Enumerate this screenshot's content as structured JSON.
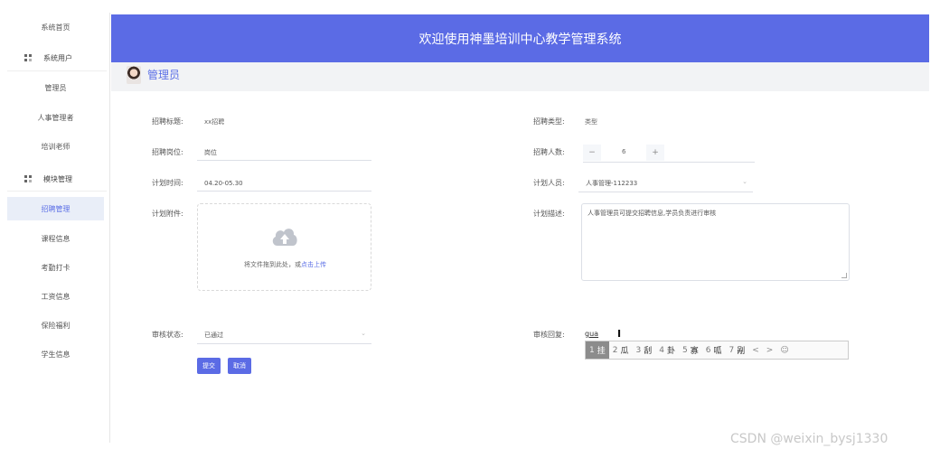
{
  "sidebar": {
    "items": [
      {
        "label": "系统首页"
      },
      {
        "label": "系统用户",
        "group": true
      },
      {
        "label": "管理员"
      },
      {
        "label": "人事管理者"
      },
      {
        "label": "培训老师"
      },
      {
        "label": "模块管理",
        "group": true
      },
      {
        "label": "招聘管理",
        "active": true
      },
      {
        "label": "课程信息"
      },
      {
        "label": "考勤打卡"
      },
      {
        "label": "工资信息"
      },
      {
        "label": "保险福利"
      },
      {
        "label": "学生信息"
      }
    ]
  },
  "header": {
    "title": "欢迎使用神墨培训中心教学管理系统"
  },
  "user": {
    "name": "管理员"
  },
  "form": {
    "recruit_title_label": "招聘标题:",
    "recruit_title_value": "xx招聘",
    "recruit_type_label": "招聘类型:",
    "recruit_type_value": "类型",
    "position_label": "招聘岗位:",
    "position_value": "岗位",
    "count_label": "招聘人数:",
    "count_value": "6",
    "count_minus": "−",
    "count_plus": "+",
    "plan_time_label": "计划时间:",
    "plan_time_value": "04.20-05.30",
    "plan_person_label": "计划人员:",
    "plan_person_value": "人事管理-112233",
    "attachment_label": "计划附件:",
    "upload_text": "将文件拖到此处，或",
    "upload_link": "点击上传",
    "desc_label": "计划描述:",
    "desc_value": "人事管理员可提交招聘信息,学员负责进行审核",
    "audit_status_label": "审核状态:",
    "audit_status_value": "已通过",
    "audit_reply_label": "审核回复:",
    "audit_reply_value": "gua",
    "submit_label": "提交",
    "cancel_label": "取消"
  },
  "ime": {
    "candidates": [
      {
        "n": "1",
        "c": "挂",
        "selected": true
      },
      {
        "n": "2",
        "c": "瓜"
      },
      {
        "n": "3",
        "c": "刮"
      },
      {
        "n": "4",
        "c": "卦"
      },
      {
        "n": "5",
        "c": "寡"
      },
      {
        "n": "6",
        "c": "呱"
      },
      {
        "n": "7",
        "c": "剐"
      }
    ],
    "prev": "<",
    "next": ">",
    "emoji": "☺"
  },
  "watermark": "CSDN @weixin_bysj1330",
  "colors": {
    "accent": "#5b6be5",
    "active_bg": "#e9eef8"
  }
}
